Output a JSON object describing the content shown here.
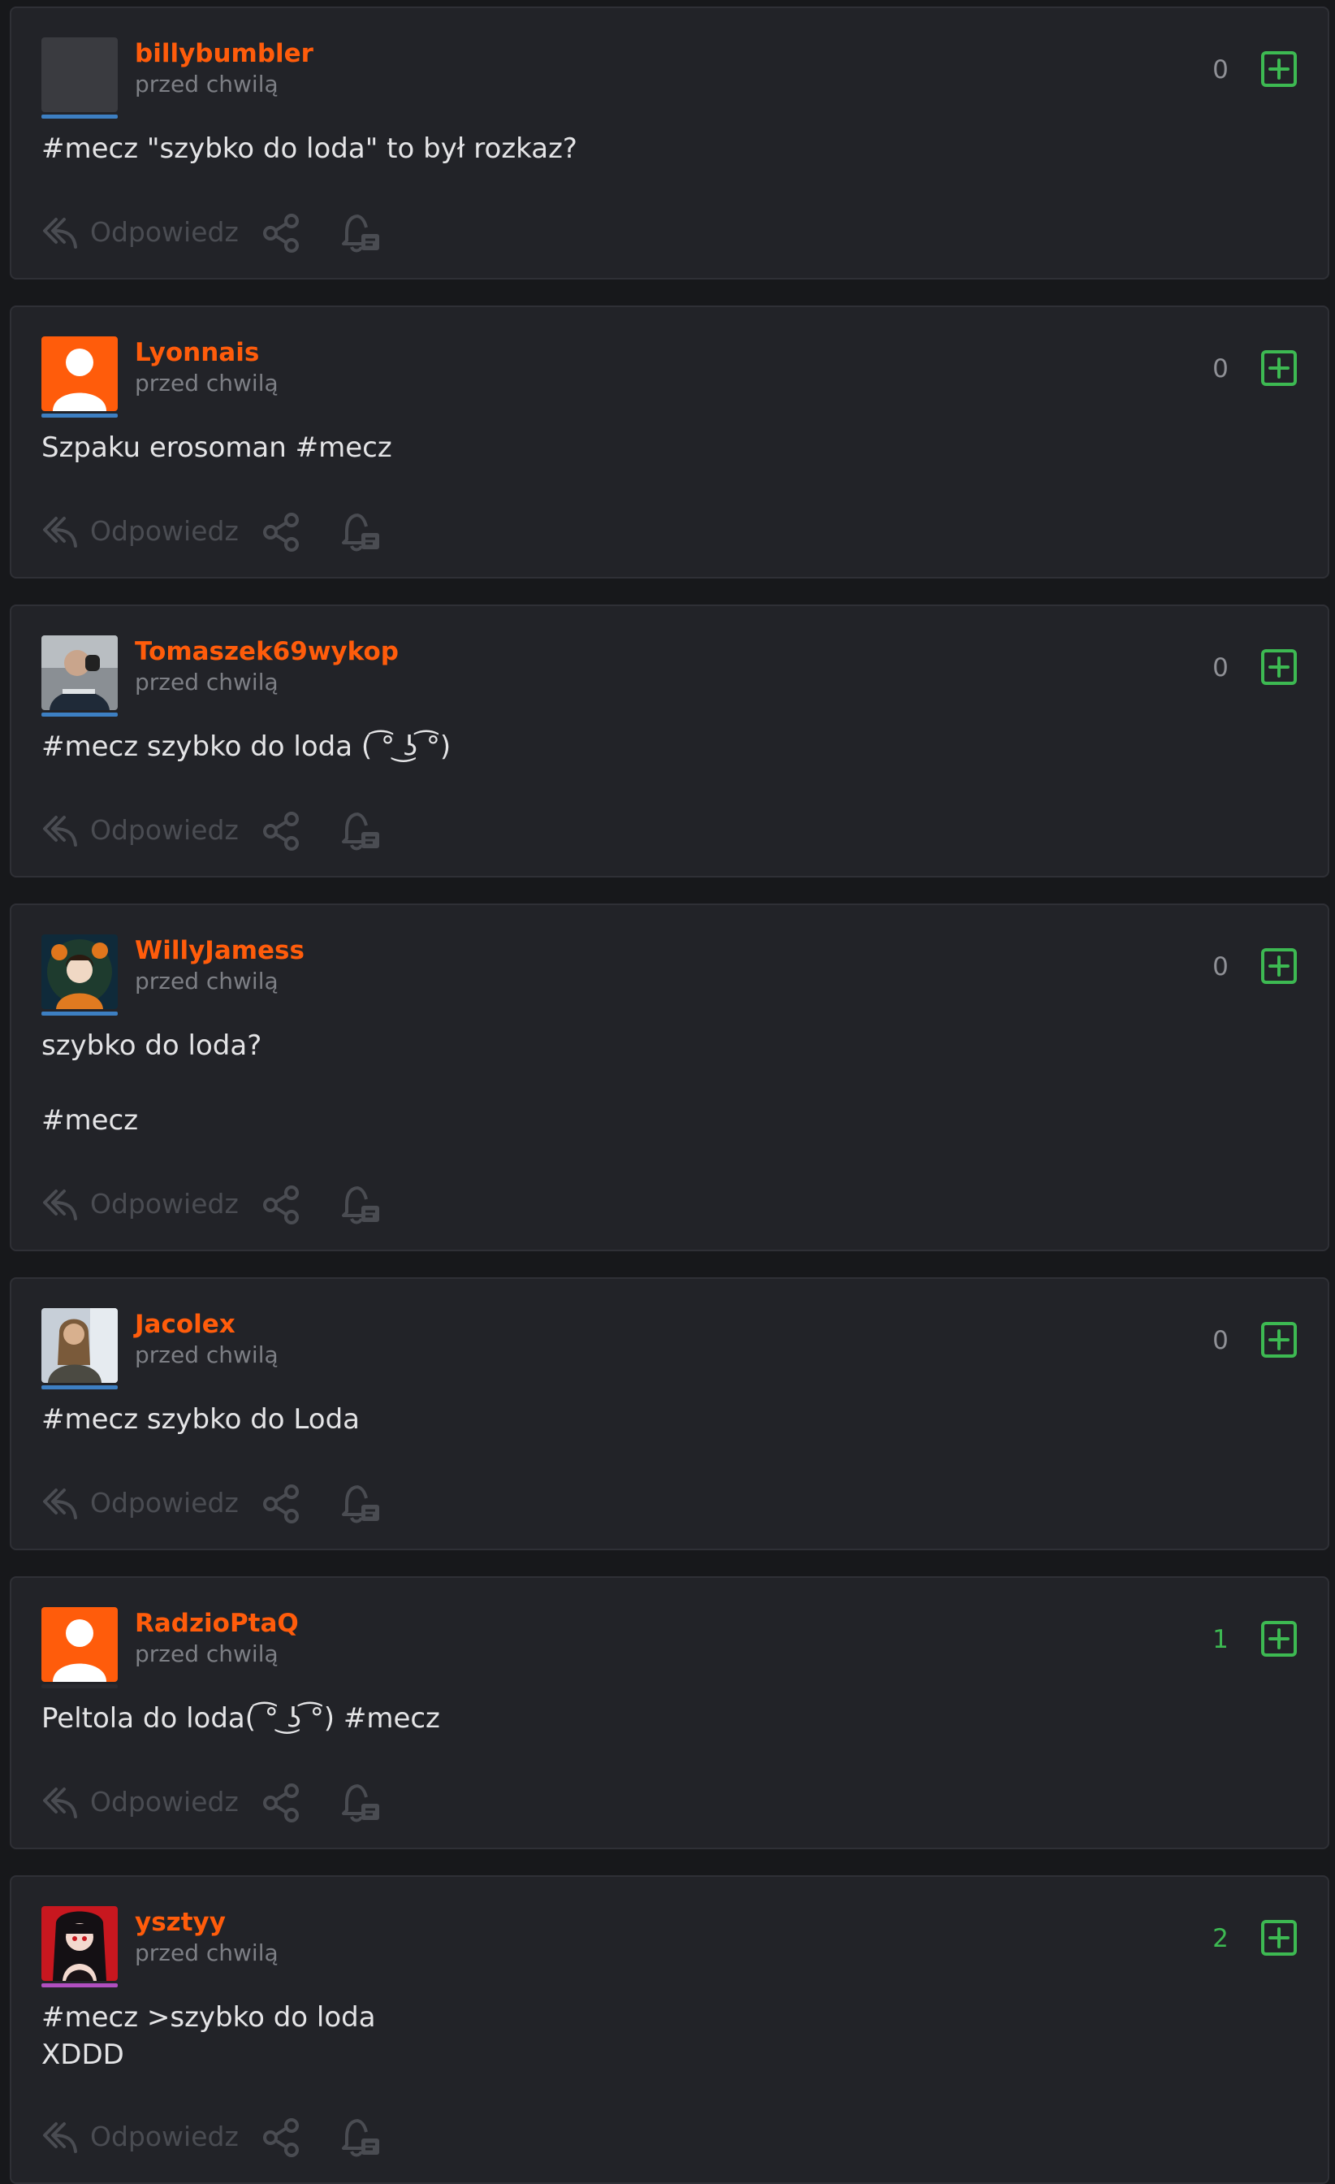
{
  "ui": {
    "reply_label": "Odpowiedz",
    "time_label": "przed chwilą",
    "icons": {
      "reply": "reply-icon",
      "share": "share-icon",
      "notify": "bell-icon",
      "plus": "plus-icon"
    },
    "colors": {
      "username": "#ff5c0b",
      "positive_vote": "#3db952",
      "neutral_vote": "#8f9096",
      "background": "#17181b",
      "card": "#222328"
    }
  },
  "comments": [
    {
      "username": "billybumbler",
      "time": "przed chwilą",
      "votes": "0",
      "text": "#mecz \"szybko do loda\" to był rozkaz?",
      "avatar": "blank-gray",
      "bar_color": "#3d7fc2"
    },
    {
      "username": "Lyonnais",
      "time": "przed chwilą",
      "votes": "0",
      "text": "Szpaku erosoman #mecz",
      "avatar": "default-orange",
      "bar_color": "#3d7fc2"
    },
    {
      "username": "Tomaszek69wykop",
      "time": "przed chwilą",
      "votes": "0",
      "text": "#mecz szybko do loda ( ͡° ͜ʖ ͡°)",
      "avatar": "photo-man",
      "bar_color": "#3d7fc2"
    },
    {
      "username": "WillyJamess",
      "time": "przed chwilą",
      "votes": "0",
      "text": "szybko do loda?\n\n#mecz",
      "avatar": "photo-halloween",
      "bar_color": "#3d7fc2"
    },
    {
      "username": "Jacolex",
      "time": "przed chwilą",
      "votes": "0",
      "text": "#mecz szybko do Loda",
      "avatar": "photo-woman",
      "bar_color": "#3d7fc2"
    },
    {
      "username": "RadzioPtaQ",
      "time": "przed chwilą",
      "votes": "1",
      "text": "Peltola do loda( ͡° ͜ʖ ͡°) #mecz",
      "avatar": "default-orange",
      "bar_color": "#2a2b30"
    },
    {
      "username": "ysztyy",
      "time": "przed chwilą",
      "votes": "2",
      "text": "#mecz >szybko do loda\nXDDD",
      "avatar": "photo-anime",
      "bar_color": "#b04fc0"
    }
  ]
}
